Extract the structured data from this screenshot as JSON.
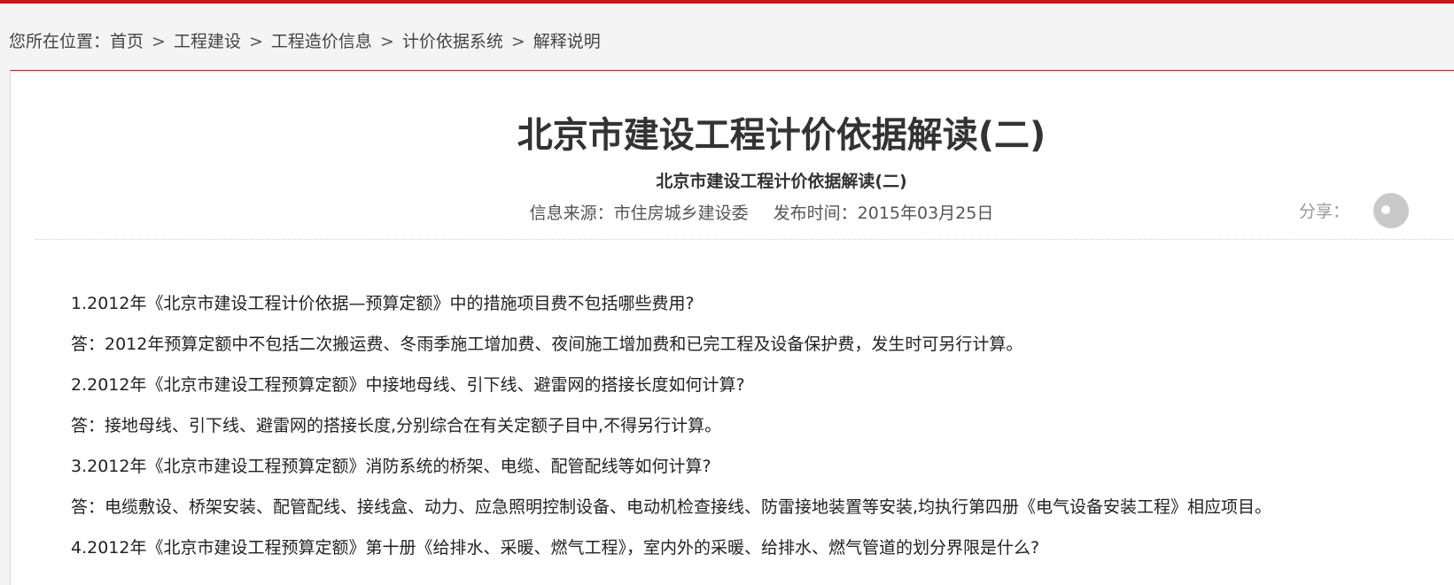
{
  "breadcrumb": {
    "prefix": "您所在位置：",
    "items": [
      "首页",
      "工程建设",
      "工程造价信息",
      "计价依据系统",
      "解释说明"
    ],
    "separator": ">"
  },
  "article": {
    "title": "北京市建设工程计价依据解读(二)",
    "subtitle": "北京市建设工程计价依据解读(二)",
    "source_label": "信息来源：市住房城乡建设委",
    "date_label": "发布时间：2015年03月25日",
    "share_label": "分享：",
    "paragraphs": [
      "1.2012年《北京市建设工程计价依据—预算定额》中的措施项目费不包括哪些费用?",
      "答：2012年预算定额中不包括二次搬运费、冬雨季施工增加费、夜间施工增加费和已完工程及设备保护费，发生时可另行计算。",
      "2.2012年《北京市建设工程预算定额》中接地母线、引下线、避雷网的搭接长度如何计算?",
      "答：接地母线、引下线、避雷网的搭接长度,分别综合在有关定额子目中,不得另行计算。",
      "3.2012年《北京市建设工程预算定额》消防系统的桥架、电缆、配管配线等如何计算?",
      "答：电缆敷设、桥架安装、配管配线、接线盒、动力、应急照明控制设备、电动机检查接线、防雷接地装置等安装,均执行第四册《电气设备安装工程》相应项目。",
      "4.2012年《北京市建设工程预算定额》第十册《给排水、采暖、燃气工程》，室内外的采暖、给排水、燃气管道的划分界限是什么?"
    ]
  },
  "colors": {
    "accent": "#c8161e",
    "text": "#333333",
    "muted": "#999999"
  }
}
